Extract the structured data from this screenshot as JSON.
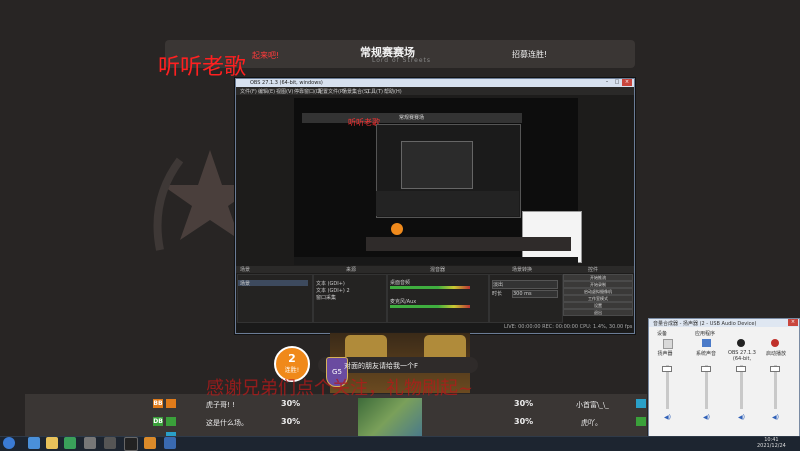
{
  "stream_overlay": {
    "host_name": "听听老歌",
    "cheer_text": "起来吧!",
    "banner_title": "常规赛赛场",
    "banner_subtitle": "Lord of Streets",
    "banner_right": "招募连胜!"
  },
  "obs": {
    "window_title": "OBS 27.1.3 (64-bit, windows)",
    "menu": [
      "文件(F)",
      "编辑(E)",
      "视图(V)",
      "停靠窗口(D)",
      "配置文件(P)",
      "场景集合(S)",
      "工具(T)",
      "帮助(H)"
    ],
    "inner_banner_title": "常规赛赛场",
    "inner_host_name": "听听老歌",
    "docks": [
      "场景",
      "来源",
      "混音器",
      "场景转换",
      "控件"
    ],
    "scene_items": [
      "场景"
    ],
    "sources": [
      "文本 (GDI+)",
      "文本 (GDI+) 2",
      "窗口采集"
    ],
    "mixer_tracks": [
      "桌面音频",
      "麦克风/Aux"
    ],
    "transition": "淡出",
    "duration_label": "时长",
    "duration_value": "300 ms",
    "controls": [
      "开始推流",
      "开始录制",
      "启动虚拟摄像机",
      "工作室模式",
      "设置",
      "退出"
    ],
    "status": "LIVE: 00:00:00   REC: 00:00:00   CPU: 1.4%, 30.00 fps"
  },
  "stage": {
    "round_number": "2",
    "round_label": "连胜!",
    "game_tag": "对面的朋友请给我一个F",
    "shield_level": "G5",
    "scroll_text": "感谢兄弟们点个关注，礼物刷起~"
  },
  "score_table": {
    "rows": [
      {
        "left_tag": "BB",
        "left_tag_color": "#e07b1a",
        "left_player": "虎子哥! !",
        "left_pct": "30%",
        "right_pct": "30%",
        "right_player": "小首富\\_\\_",
        "right_tag_color": "#2aa0c8"
      },
      {
        "left_tag": "DB",
        "left_tag_color": "#3aa03a",
        "left_player": "这是什么场。",
        "left_pct": "30%",
        "right_pct": "30%",
        "right_player": "虎吖。",
        "right_tag_color": "#3aa03a"
      },
      {
        "left_tag": "",
        "left_tag_color": "#2aa0c8",
        "left_player": "",
        "left_pct": "",
        "right_pct": "",
        "right_player": "",
        "right_tag_color": "#2aa0c8"
      }
    ]
  },
  "audio_mixer": {
    "window_title": "音量合成器 - 扬声器 (2 - USB Audio Device)",
    "labels": [
      "设备",
      "应用程序"
    ],
    "channels": [
      "扬声器",
      "系统声音",
      "OBS 27.1.3 (64-bit, window...",
      "启动播放"
    ]
  },
  "taskbar": {
    "time": "10:41",
    "date": "2021/12/24"
  }
}
